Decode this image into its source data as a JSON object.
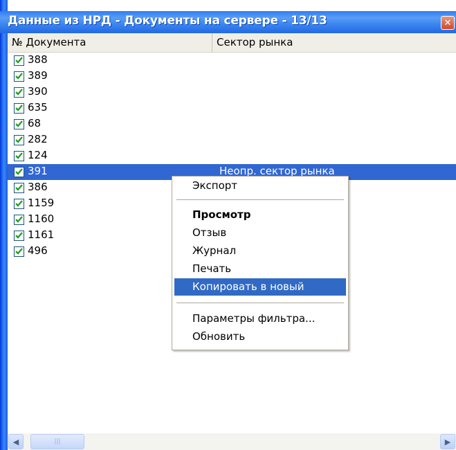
{
  "window": {
    "title": "Данные из НРД - Документы на сервере - 13/13",
    "close_icon": "close-icon"
  },
  "columns": [
    "№ Документа",
    "Сектор рынка"
  ],
  "rows": [
    {
      "num": "388",
      "checked": true,
      "sector": ""
    },
    {
      "num": "389",
      "checked": true,
      "sector": ""
    },
    {
      "num": "390",
      "checked": true,
      "sector": ""
    },
    {
      "num": "635",
      "checked": true,
      "sector": ""
    },
    {
      "num": "68",
      "checked": true,
      "sector": ""
    },
    {
      "num": "282",
      "checked": true,
      "sector": ""
    },
    {
      "num": "124",
      "checked": true,
      "sector": ""
    },
    {
      "num": "391",
      "checked": true,
      "sector": "Неопр. сектор рынка",
      "selected": true
    },
    {
      "num": "386",
      "checked": true,
      "sector": ""
    },
    {
      "num": "1159",
      "checked": true,
      "sector": ""
    },
    {
      "num": "1160",
      "checked": true,
      "sector": ""
    },
    {
      "num": "1161",
      "checked": true,
      "sector": ""
    },
    {
      "num": "496",
      "checked": true,
      "sector": ""
    }
  ],
  "context_menu": {
    "export": "Экспорт",
    "view": "Просмотр",
    "recall": "Отзыв",
    "journal": "Журнал",
    "print": "Печать",
    "copy_new": "Копировать в новый",
    "filter_params": "Параметры фильтра...",
    "refresh": "Обновить"
  },
  "colors": {
    "selection": "#3167d3",
    "menu_highlight": "#316ac5",
    "checkmark": "#21a121"
  }
}
